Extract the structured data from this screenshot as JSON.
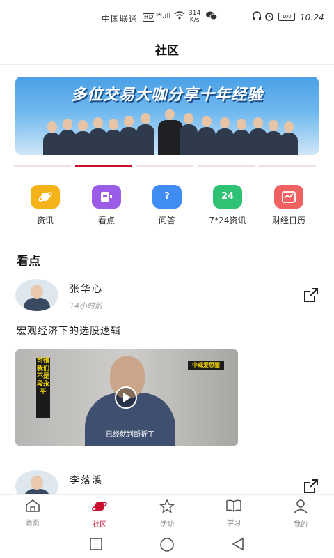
{
  "status_bar": {
    "carrier": "中国联通",
    "hd": "HD",
    "signal": "⁵⁶.ıll",
    "speed_value": "314",
    "speed_unit": "K/s",
    "battery": "100",
    "time": "10:24"
  },
  "header": {
    "title": "社区"
  },
  "banner": {
    "headline": "多位交易大咖分享十年经验",
    "carousel_count": 5,
    "carousel_active_index": 1
  },
  "quick_links": [
    {
      "label": "资讯",
      "icon": "planet-icon",
      "color": "#f5b31a",
      "glyph": ""
    },
    {
      "label": "看点",
      "icon": "video-icon",
      "color": "#9b5ce8",
      "glyph": ""
    },
    {
      "label": "问答",
      "icon": "question-icon",
      "color": "#3f8df3",
      "glyph": "?"
    },
    {
      "label": "7*24资讯",
      "icon": "calendar-24-icon",
      "color": "#2fc275",
      "glyph": "24"
    },
    {
      "label": "财经日历",
      "icon": "finance-calendar-icon",
      "color": "#f06262",
      "glyph": ""
    }
  ],
  "section": {
    "title": "看点"
  },
  "posts": [
    {
      "author": "张华心",
      "time_ago": "14小时前",
      "title": "宏观经济下的选股逻辑",
      "video": {
        "left_banner": "可惜我们不是段永平",
        "right_banner": "中观爱思丽",
        "caption": "已经就判断折了"
      }
    },
    {
      "author": "李落溪",
      "time_ago": ""
    }
  ],
  "tabbar": [
    {
      "label": "首页",
      "icon": "home-icon"
    },
    {
      "label": "社区",
      "icon": "planet-icon"
    },
    {
      "label": "活动",
      "icon": "star-icon"
    },
    {
      "label": "学习",
      "icon": "book-icon"
    },
    {
      "label": "我的",
      "icon": "person-icon"
    }
  ],
  "tabbar_active": "社区",
  "colors": {
    "accent": "#c8102e"
  }
}
